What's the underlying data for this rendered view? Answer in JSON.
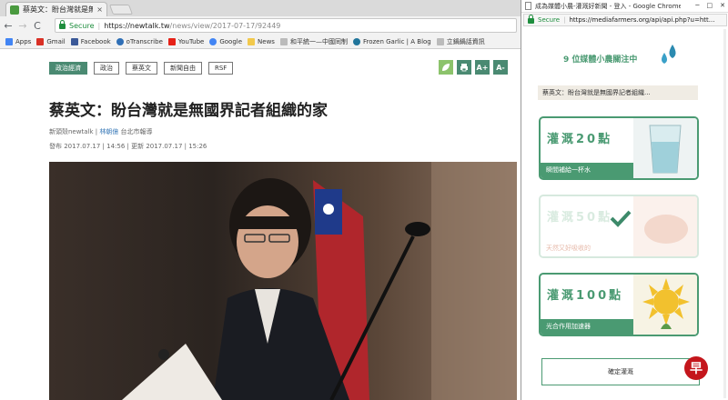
{
  "main_window": {
    "tab": {
      "title": "蔡英文：盼台灣就是無國界記者組織的家",
      "close": "×"
    },
    "toolbar": {
      "back": "←",
      "forward": "→",
      "reload": "C",
      "secure_label": "Secure",
      "url_host": "https://newtalk.tw",
      "url_path": "/news/view/2017-07-17/92449"
    },
    "bookmarks": [
      {
        "label": "Apps",
        "icon": "apps-icon",
        "color": "#4285f4"
      },
      {
        "label": "Gmail",
        "icon": "gmail-icon",
        "color": "#d93025"
      },
      {
        "label": "Facebook",
        "icon": "facebook-icon",
        "color": "#3b5998"
      },
      {
        "label": "oTranscribe",
        "icon": "otranscribe-icon",
        "color": "#2f6fb6"
      },
      {
        "label": "YouTube",
        "icon": "youtube-icon",
        "color": "#e62117"
      },
      {
        "label": "Google",
        "icon": "google-icon",
        "color": "#4285f4"
      },
      {
        "label": "News",
        "icon": "folder-icon",
        "color": "#f2c94c"
      },
      {
        "label": "和平統一—中國同制",
        "icon": "page-icon",
        "color": "#999999"
      },
      {
        "label": "Frozen Garlic | A Blog",
        "icon": "wordpress-icon",
        "color": "#21759b"
      },
      {
        "label": "立鍋鍋話資訊",
        "icon": "page-icon",
        "color": "#999999"
      }
    ]
  },
  "article": {
    "tags": [
      "政治經濟",
      "政治",
      "蔡英文",
      "新聞自由",
      "RSF"
    ],
    "tools": [
      {
        "label": "",
        "icon": "leaf-icon"
      },
      {
        "label": "",
        "icon": "print-icon"
      },
      {
        "label": "A+",
        "icon": "font-larger-icon"
      },
      {
        "label": "A-",
        "icon": "font-smaller-icon"
      }
    ],
    "headline": "蔡英文：盼台灣就是無國界記者組織的家",
    "source": "新頭殼newtalk | ",
    "author": "林朝億",
    "location": " 台北市報導",
    "published": "發布 2017.07.17 | 14:56 | 更新 2017.07.17 | 15:26"
  },
  "popup": {
    "title": "成為媒體小農-灌溉好新聞 - 登入 - Google Chrome",
    "secure_label": "Secure",
    "url": "https://mediafarmers.org/api/api.php?u=htt...",
    "watch_text": "9 位媒體小農關注中",
    "article_title": "蔡英文：盼台灣就是無國界記者組織...",
    "cards": [
      {
        "label": "灌溉20點",
        "foot": "瞬間補給一杯水"
      },
      {
        "label": "灌溉50點",
        "foot": "天然又好吸收的"
      },
      {
        "label": "灌溉100點",
        "foot": "光合作用加速器"
      }
    ],
    "confirm_label": "確定灌溉"
  },
  "watermark": "早",
  "colors": {
    "accent": "#4a8a72",
    "popup_green": "#4a9a72",
    "secure": "#1e8e3e"
  }
}
